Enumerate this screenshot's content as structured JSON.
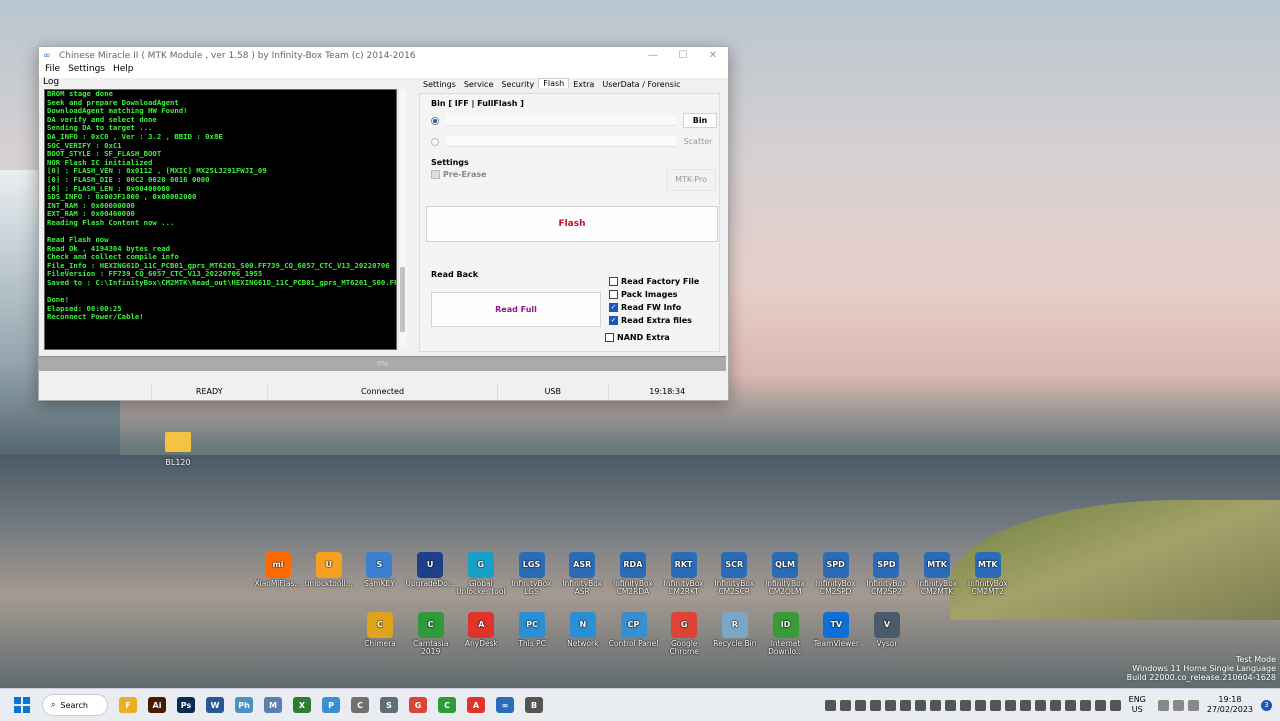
{
  "window": {
    "title": "Chinese Miracle II ( MTK Module , ver 1.58 ) by Infinity-Box Team (c) 2014-2016",
    "menu": [
      "File",
      "Settings",
      "Help"
    ],
    "log_label": "Log",
    "log_lines": [
      "BROM stage done",
      "Seek and prepare DownloadAgent",
      "DownloadAgent matching HW Found!",
      "DA verify and select done",
      "Sending DA to target ...",
      "DA_INFO : 0xC0 , Ver : 3.2 , BBID : 0x8E",
      "SOC_VERIFY : 0xC1",
      "BOOT_STYLE : SF_FLASH_BOOT",
      "NOR Flash IC initialized",
      "[0] : FLASH_VEN : 0x0112 , [MXIC] MX25L3291FWJI_09",
      "[0] : FLASH_DIE : 00C2 0020 0016 0000",
      "[0] : FLASH_LEN : 0x00400000",
      "SDS_INFO : 0x003F1000 , 0x00002000",
      "INT_RAM : 0x00000000",
      "EXT_RAM : 0x00400000",
      "Reading Flash Content now ...",
      "",
      "Read Flash now",
      "Read Ok , 4194304 bytes read",
      "Check and collect compile info",
      "File_Info : HEXING61D_11C_PCB01_gprs_MT6261_S00.FF739_CQ_6057_CTC_V13_20220706",
      "FileVersion : FF739_CQ_6057_CTC_V13_20220706_1955",
      "Saved to : C:\\InfinityBox\\CM2MTK\\Read_out\\HEXING61D_11C_PCB01_gprs_MT6261_S00.FF7",
      "",
      "Done!",
      "Elapsed: 00:00:25",
      "Reconnect Power/Cable!"
    ],
    "tabs": [
      "Settings",
      "Service",
      "Security",
      "Flash",
      "Extra",
      "UserData / Forensic"
    ],
    "active_tab": "Flash",
    "flash": {
      "bin_group": "Bin  [ IFF | FullFlash ]",
      "bin_button": "Bin",
      "scatter_button": "Scatter",
      "settings_label": "Settings",
      "pre_erase": "Pre-Erase",
      "mtk_pro": "MTK-Pro",
      "flash_button": "Flash",
      "read_back_label": "Read Back",
      "read_full_button": "Read Full",
      "options": [
        {
          "label": "Read Factory File",
          "checked": false
        },
        {
          "label": "Pack Images",
          "checked": false
        },
        {
          "label": "Read FW Info",
          "checked": true
        },
        {
          "label": "Read Extra files",
          "checked": true
        }
      ],
      "nand_extra": "NAND Extra"
    },
    "progress_text": "0%",
    "status": {
      "state": "READY",
      "connection": "Connected",
      "port": "USB",
      "time": "19:18:34"
    }
  },
  "desktop": {
    "folder": "BL120",
    "icons_row1": [
      {
        "label": "XiaoMiFlas...",
        "tag": "mi",
        "color": "#ff6a00"
      },
      {
        "label": "unlocktooll...",
        "tag": "U",
        "color": "#f5a020"
      },
      {
        "label": "SamKEY",
        "tag": "S",
        "color": "#3a7fd0"
      },
      {
        "label": "UpgradeDo...",
        "tag": "U",
        "color": "#1e3f8a"
      },
      {
        "label": "Global Unlocker tool",
        "tag": "G",
        "color": "#16a0c8"
      },
      {
        "label": "InfinityBox LGS",
        "tag": "LGS",
        "color": "#2b6cb8"
      },
      {
        "label": "InfinityBox ASR",
        "tag": "ASR",
        "color": "#2b6cb8"
      },
      {
        "label": "InfinityBox CM2RDA",
        "tag": "RDA",
        "color": "#2b6cb8"
      },
      {
        "label": "InfinityBox CM2RKT",
        "tag": "RKT",
        "color": "#2b6cb8"
      },
      {
        "label": "InfinityBox CM2SCR",
        "tag": "SCR",
        "color": "#2b6cb8"
      },
      {
        "label": "InfinityBox CM2QLM",
        "tag": "QLM",
        "color": "#2b6cb8"
      },
      {
        "label": "InfinityBox CM2SPD",
        "tag": "SPD",
        "color": "#2b6cb8"
      },
      {
        "label": "InfinityBox CM2SP2",
        "tag": "SPD",
        "color": "#2b6cb8"
      },
      {
        "label": "InfinityBox CM2MTK",
        "tag": "MTK",
        "color": "#2b6cb8"
      },
      {
        "label": "InfinityBox CM2MT2",
        "tag": "MTK",
        "color": "#2b6cb8"
      }
    ],
    "icons_row2": [
      {
        "label": "Chimera",
        "tag": "C",
        "color": "#e0a41c"
      },
      {
        "label": "Camtasia 2019",
        "tag": "C",
        "color": "#2e9a3a"
      },
      {
        "label": "AnyDesk",
        "tag": "A",
        "color": "#e0332a"
      },
      {
        "label": "This PC",
        "tag": "PC",
        "color": "#2b8fd6"
      },
      {
        "label": "Network",
        "tag": "N",
        "color": "#2b8fd6"
      },
      {
        "label": "Control Panel",
        "tag": "CP",
        "color": "#3a8fd0"
      },
      {
        "label": "Google Chrome",
        "tag": "G",
        "color": "#db4437"
      },
      {
        "label": "Recycle Bin",
        "tag": "R",
        "color": "#7aa7c8"
      },
      {
        "label": "Internet Downlo...",
        "tag": "ID",
        "color": "#3a9a3a"
      },
      {
        "label": "TeamViewer",
        "tag": "TV",
        "color": "#0e6fd8"
      },
      {
        "label": "Vysor",
        "tag": "V",
        "color": "#4a5a6a"
      }
    ],
    "watermark": [
      "Test Mode",
      "Windows 11 Home Single Language",
      "Build 22000.co_release.210604-1628"
    ]
  },
  "taskbar": {
    "search": "Search",
    "apps": [
      {
        "tag": "F",
        "color": "#e8b020"
      },
      {
        "tag": "Ai",
        "color": "#4a1a00"
      },
      {
        "tag": "Ps",
        "color": "#0b2b50"
      },
      {
        "tag": "W",
        "color": "#2b5797"
      },
      {
        "tag": "Ph",
        "color": "#4a90c0"
      },
      {
        "tag": "M",
        "color": "#5a7fb0"
      },
      {
        "tag": "X",
        "color": "#2e7d32"
      },
      {
        "tag": "P",
        "color": "#3a8fd0"
      },
      {
        "tag": "C",
        "color": "#707070"
      },
      {
        "tag": "S",
        "color": "#606c78"
      },
      {
        "tag": "G",
        "color": "#db4437"
      },
      {
        "tag": "C",
        "color": "#2e9a3a"
      },
      {
        "tag": "A",
        "color": "#e0332a"
      },
      {
        "tag": "∞",
        "color": "#2b6cb8"
      },
      {
        "tag": "B",
        "color": "#555"
      }
    ],
    "lang": [
      "ENG",
      "US"
    ],
    "time": "19:18",
    "date": "27/02/2023",
    "notifications": "3"
  }
}
